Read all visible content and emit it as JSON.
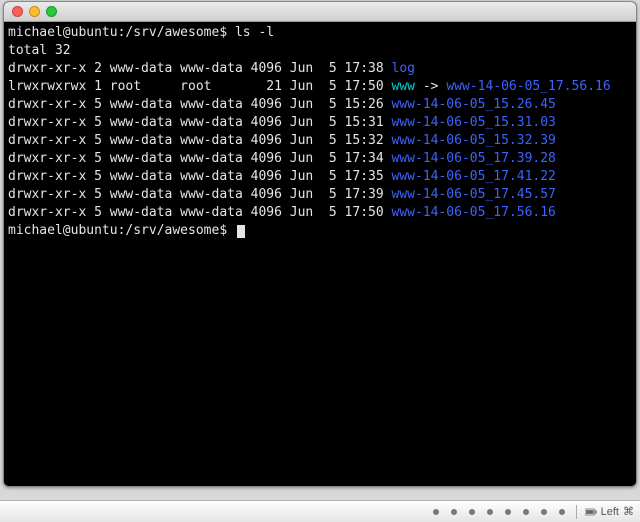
{
  "prompt": {
    "user_host": "michael@ubuntu",
    "path": ":/srv/awesome$",
    "command": "ls -l",
    "closer": "michael@ubuntu:/srv/awesome$ "
  },
  "total_line": "total 32",
  "entries": [
    {
      "attrs": "drwxr-xr-x 2 www-data www-data 4096 Jun  5 17:38 ",
      "name": "log",
      "type": "dir"
    },
    {
      "attrs": "lrwxrwxrwx 1 root     root       21 Jun  5 17:50 ",
      "name": "www",
      "type": "lnk",
      "arrow": " -> ",
      "target": "www-14-06-05_17.56.16"
    },
    {
      "attrs": "drwxr-xr-x 5 www-data www-data 4096 Jun  5 15:26 ",
      "name": "www-14-06-05_15.26.45",
      "type": "dir"
    },
    {
      "attrs": "drwxr-xr-x 5 www-data www-data 4096 Jun  5 15:31 ",
      "name": "www-14-06-05_15.31.03",
      "type": "dir"
    },
    {
      "attrs": "drwxr-xr-x 5 www-data www-data 4096 Jun  5 15:32 ",
      "name": "www-14-06-05_15.32.39",
      "type": "dir"
    },
    {
      "attrs": "drwxr-xr-x 5 www-data www-data 4096 Jun  5 17:34 ",
      "name": "www-14-06-05_17.39.28",
      "type": "dir"
    },
    {
      "attrs": "drwxr-xr-x 5 www-data www-data 4096 Jun  5 17:35 ",
      "name": "www-14-06-05_17.41.22",
      "type": "dir"
    },
    {
      "attrs": "drwxr-xr-x 5 www-data www-data 4096 Jun  5 17:39 ",
      "name": "www-14-06-05_17.45.57",
      "type": "dir"
    },
    {
      "attrs": "drwxr-xr-x 5 www-data www-data 4096 Jun  5 17:50 ",
      "name": "www-14-06-05_17.56.16",
      "type": "dir"
    }
  ],
  "statusbar": {
    "battery_icon": "battery",
    "indicator_text": "Left",
    "cmd_symbol": "⌘"
  }
}
